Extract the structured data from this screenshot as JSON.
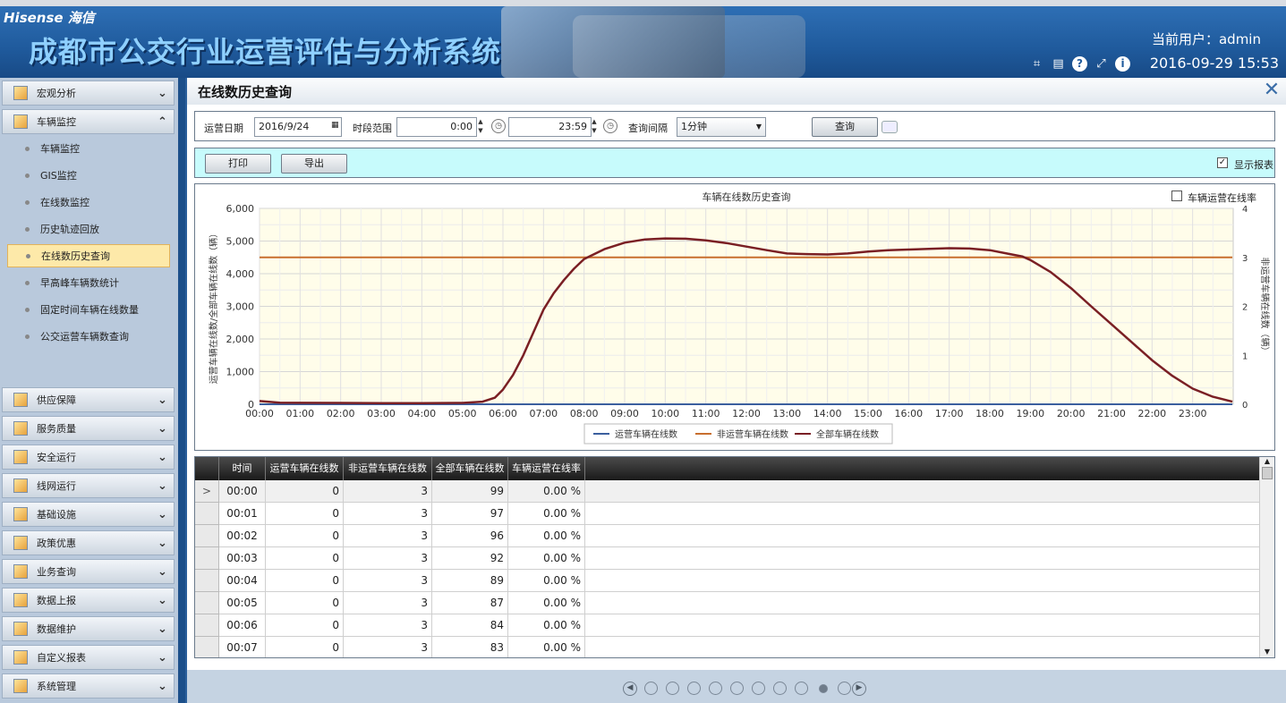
{
  "app": {
    "brand": "Hisense 海信",
    "title": "成都市公交行业运营评估与分析系统",
    "user_label": "当前用户：admin",
    "datetime": "2016-09-29 15:53"
  },
  "header_icons": [
    "crop-icon",
    "keyboard-icon",
    "help-icon",
    "fullscreen-icon",
    "info-icon"
  ],
  "sidebar": {
    "groups_top": [
      {
        "label": "宏观分析",
        "expanded": false
      },
      {
        "label": "车辆监控",
        "expanded": true
      }
    ],
    "sub_items": [
      {
        "label": "车辆监控"
      },
      {
        "label": "GIS监控"
      },
      {
        "label": "在线数监控"
      },
      {
        "label": "历史轨迹回放"
      },
      {
        "label": "在线数历史查询"
      },
      {
        "label": "早高峰车辆数统计"
      },
      {
        "label": "固定时间车辆在线数量"
      },
      {
        "label": "公交运营车辆数查询"
      }
    ],
    "active_index": 4,
    "groups_bottom": [
      {
        "label": "供应保障"
      },
      {
        "label": "服务质量"
      },
      {
        "label": "安全运行"
      },
      {
        "label": "线网运行"
      },
      {
        "label": "基础设施"
      },
      {
        "label": "政策优惠"
      },
      {
        "label": "业务查询"
      },
      {
        "label": "数据上报"
      },
      {
        "label": "数据维护"
      },
      {
        "label": "自定义报表"
      },
      {
        "label": "系统管理"
      }
    ]
  },
  "page": {
    "title": "在线数历史查询"
  },
  "query": {
    "date_label": "运营日期",
    "date_value": "2016/9/24",
    "range_label": "时段范围",
    "time_start": "0:00",
    "time_end": "23:59",
    "interval_label": "查询间隔",
    "interval_value": "1分钟",
    "query_button": "查询"
  },
  "toolbar": {
    "print_button": "打印",
    "export_button": "导出",
    "show_report_label": "显示报表",
    "show_report_checked": true
  },
  "chart_data": {
    "type": "line",
    "title": "车辆在线数历史查询",
    "ylabel": "运营车辆在线数/全部车辆在线数（辆）",
    "y2label": "非运营车辆在线数（辆）",
    "ylim": [
      0,
      6000
    ],
    "y_ticks": [
      "0",
      "1,000",
      "2,000",
      "3,000",
      "4,000",
      "5,000",
      "6,000"
    ],
    "y2lim": [
      0,
      4
    ],
    "y2_ticks": [
      "0",
      "1",
      "2",
      "3",
      "4"
    ],
    "x_ticks": [
      "00:00",
      "01:00",
      "02:00",
      "03:00",
      "04:00",
      "05:00",
      "06:00",
      "07:00",
      "08:00",
      "09:00",
      "10:00",
      "11:00",
      "12:00",
      "13:00",
      "14:00",
      "15:00",
      "16:00",
      "17:00",
      "18:00",
      "19:00",
      "20:00",
      "21:00",
      "22:00",
      "23:00"
    ],
    "rate_checkbox_label": "车辆运营在线率",
    "rate_checkbox_checked": false,
    "legend_position": "bottom",
    "series": [
      {
        "name": "运营车辆在线数",
        "color": "#3b5f9e",
        "axis": "left",
        "x": [
          0,
          23.98
        ],
        "y": [
          0,
          0
        ]
      },
      {
        "name": "非运营车辆在线数",
        "color": "#c86e2e",
        "axis": "right",
        "x": [
          0,
          23.98
        ],
        "y": [
          3,
          3
        ]
      },
      {
        "name": "全部车辆在线数",
        "color": "#7a1f24",
        "axis": "left",
        "x": [
          0,
          0.5,
          1,
          2,
          3,
          4,
          5,
          5.5,
          5.8,
          6,
          6.25,
          6.5,
          6.75,
          7,
          7.25,
          7.5,
          7.75,
          8,
          8.25,
          8.5,
          9,
          9.5,
          10,
          10.5,
          11,
          11.5,
          12,
          12.5,
          13,
          13.5,
          14,
          14.5,
          15,
          15.5,
          16,
          16.5,
          17,
          17.5,
          18,
          18.5,
          18.8,
          19,
          19.5,
          20,
          20.5,
          21,
          21.5,
          22,
          22.5,
          23,
          23.5,
          23.98
        ],
        "y": [
          99,
          50,
          45,
          40,
          35,
          35,
          40,
          80,
          200,
          450,
          900,
          1500,
          2200,
          2900,
          3400,
          3800,
          4150,
          4450,
          4600,
          4750,
          4950,
          5050,
          5080,
          5070,
          5020,
          4940,
          4830,
          4720,
          4620,
          4600,
          4590,
          4620,
          4680,
          4720,
          4740,
          4760,
          4780,
          4770,
          4720,
          4600,
          4530,
          4420,
          4050,
          3560,
          3000,
          2450,
          1900,
          1350,
          870,
          480,
          230,
          80
        ]
      }
    ]
  },
  "table": {
    "columns": [
      "时间",
      "运营车辆在线数",
      "非运营车辆在线数",
      "全部车辆在线数",
      "车辆运营在线率"
    ],
    "rows": [
      [
        "00:00",
        "0",
        "3",
        "99",
        "0.00 %"
      ],
      [
        "00:01",
        "0",
        "3",
        "97",
        "0.00 %"
      ],
      [
        "00:02",
        "0",
        "3",
        "96",
        "0.00 %"
      ],
      [
        "00:03",
        "0",
        "3",
        "92",
        "0.00 %"
      ],
      [
        "00:04",
        "0",
        "3",
        "89",
        "0.00 %"
      ],
      [
        "00:05",
        "0",
        "3",
        "87",
        "0.00 %"
      ],
      [
        "00:06",
        "0",
        "3",
        "84",
        "0.00 %"
      ],
      [
        "00:07",
        "0",
        "3",
        "83",
        "0.00 %"
      ]
    ],
    "current_row_marker": ">"
  },
  "pager": {
    "page_count": 10,
    "current_page": 9
  }
}
